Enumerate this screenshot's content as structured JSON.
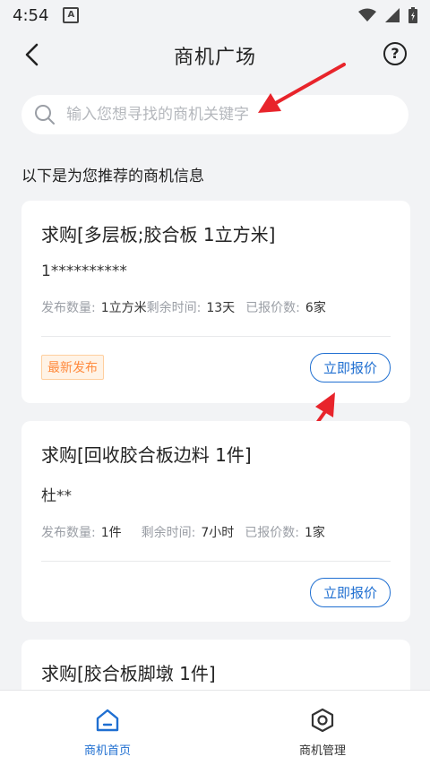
{
  "status_bar": {
    "time": "4:54",
    "notification_icon": "A"
  },
  "header": {
    "title": "商机广场",
    "help_label": "?"
  },
  "search": {
    "placeholder": "输入您想寻找的商机关键字"
  },
  "section_title": "以下是为您推荐的商机信息",
  "labels": {
    "quantity": "发布数量:",
    "remaining": "剩余时间:",
    "quotes": "已报价数:"
  },
  "cards": [
    {
      "title": "求购[多层板;胶合板 1立方米]",
      "buyer": "1**********",
      "quantity": "1立方米",
      "remaining": "13天",
      "quotes": "6家",
      "badge": "最新发布",
      "button": "立即报价"
    },
    {
      "title": "求购[回收胶合板边料 1件]",
      "buyer": "杜**",
      "quantity": "1件",
      "remaining": "7小时",
      "quotes": "1家",
      "button": "立即报价"
    },
    {
      "title": "求购[胶合板脚墩 1件]"
    }
  ],
  "tabs": [
    {
      "label": "商机首页",
      "icon": "home-icon",
      "active": true
    },
    {
      "label": "商机管理",
      "icon": "hexagon-settings-icon",
      "active": false
    }
  ],
  "colors": {
    "accent": "#1f6fd1",
    "badge": "#ff8a3d",
    "annotation_arrow": "#e8242b"
  }
}
